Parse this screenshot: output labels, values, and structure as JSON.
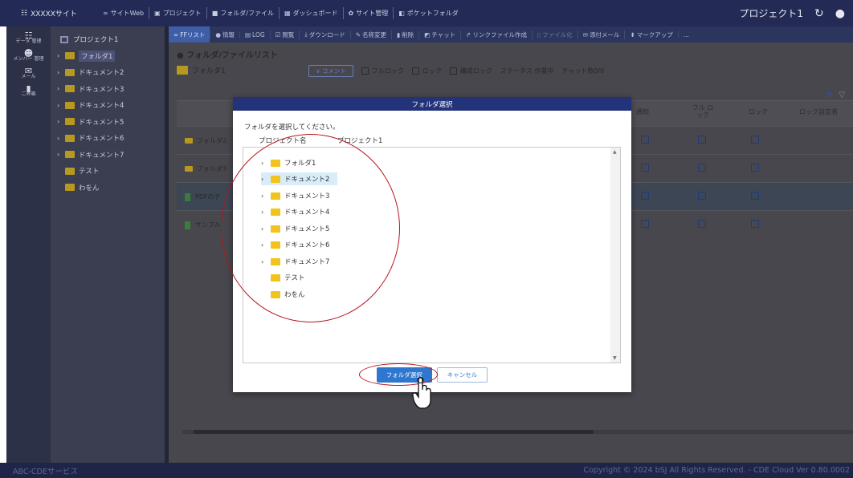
{
  "topbar": {
    "site_name": "XXXXXサイト",
    "nav": [
      "サイトWeb",
      "プロジェクト",
      "フォルダ/ファイル",
      "ダッシュボード",
      "サイト管理",
      "ポケットフォルダ"
    ],
    "project_label": "プロジェクト1"
  },
  "rail": [
    {
      "icon": "data-room-icon",
      "label": "データ 管理"
    },
    {
      "icon": "members-icon",
      "label": "メンバー 管理"
    },
    {
      "icon": "mail-icon",
      "label": "メール"
    },
    {
      "icon": "recycle-bin-icon",
      "label": "ごみ箱"
    }
  ],
  "tree": {
    "root": "プロジェクト1",
    "items": [
      "フォルダ1",
      "ドキュメント2",
      "ドキュメント3",
      "ドキュメント4",
      "ドキュメント5",
      "ドキュメント6",
      "ドキュメント7",
      "テスト",
      "わをん"
    ],
    "selected": "フォルダ1"
  },
  "toolbar": [
    "FFリスト",
    "情報",
    "LOG",
    "閲覧",
    "ダウンロード",
    "名称変更",
    "削除",
    "チャット",
    "リンクファイル作成",
    "ファイル化",
    "添付メール",
    "マークアップ",
    "..."
  ],
  "main": {
    "heading": "● フォルダ/ファイルリスト",
    "folder": "フォルダ1",
    "comment_btn": "∨ コメント",
    "opts": [
      "フルロック",
      "ロック",
      "構成ロック"
    ],
    "status": "ステータス 作業中",
    "chat_count": "チャット数0/0",
    "headers": [
      "通知",
      "フル ロック",
      "ロック",
      "ロック設定者"
    ],
    "rows": [
      "フォルダ2",
      "フォルダ3",
      "PDFのテ",
      "サンプル"
    ]
  },
  "dialog": {
    "title": "フォルダ選択",
    "prompt": "フォルダを選択してください。",
    "project_label": "プロジェクト名",
    "project_value": "プロジェクト1",
    "items": [
      {
        "label": "フォルダ1",
        "has_children": true
      },
      {
        "label": "ドキュメント2",
        "has_children": true,
        "selected": true
      },
      {
        "label": "ドキュメント3",
        "has_children": true
      },
      {
        "label": "ドキュメント4",
        "has_children": true
      },
      {
        "label": "ドキュメント5",
        "has_children": true
      },
      {
        "label": "ドキュメント6",
        "has_children": true
      },
      {
        "label": "ドキュメント7",
        "has_children": true
      },
      {
        "label": "テスト",
        "has_children": false
      },
      {
        "label": "わをん",
        "has_children": false
      }
    ],
    "select_btn": "フォルダ選択",
    "cancel_btn": "キャンセル"
  },
  "footer": {
    "left": "ABC-CDEサービス",
    "right": "Copyright © 2024 bSJ All Rights Reserved. - CDE Cloud Ver 0.80.0002"
  },
  "colors": {
    "accent": "#2f76cf",
    "header_navy": "#23337a",
    "annotation_red": "#b5141d",
    "folder_yellow": "#f2c21d"
  }
}
